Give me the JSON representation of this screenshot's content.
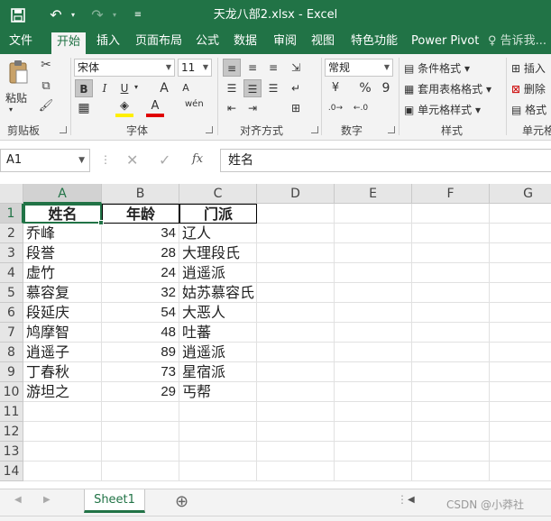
{
  "window": {
    "title": "天龙八部2.xlsx - Excel",
    "qa_save_icon": "save-icon",
    "qa_undo_icon": "undo-icon",
    "qa_redo_icon": "redo-icon",
    "qa_customize_icon": "customize-toolbar-icon"
  },
  "ribbon_tabs": [
    "文件",
    "开始",
    "插入",
    "页面布局",
    "公式",
    "数据",
    "审阅",
    "视图",
    "特色功能",
    "Power Pivot",
    "告诉我..."
  ],
  "active_tab": "开始",
  "ribbon": {
    "clipboard": {
      "label": "剪贴板",
      "paste": "粘贴"
    },
    "font": {
      "label": "字体",
      "name": "宋体",
      "size": "11",
      "bold": "B",
      "italic": "I",
      "underline": "U",
      "grow": "A",
      "shrink": "A",
      "phonetic": "wén"
    },
    "alignment": {
      "label": "对齐方式"
    },
    "number": {
      "label": "数字",
      "format": "常规",
      "percent": "%",
      "comma": "9"
    },
    "styles": {
      "label": "样式",
      "conditional": "条件格式",
      "table": "套用表格格式",
      "cell": "单元格样式"
    },
    "cells": {
      "label": "单元格",
      "insert": "插入",
      "delete": "删除",
      "format": "格式"
    }
  },
  "formula_bar": {
    "name_box": "A1",
    "fx": "fx",
    "content": "姓名"
  },
  "columns": [
    "A",
    "B",
    "C",
    "D",
    "E",
    "F",
    "G"
  ],
  "rows": [
    "1",
    "2",
    "3",
    "4",
    "5",
    "6",
    "7",
    "8",
    "9",
    "10",
    "11",
    "12",
    "13",
    "14"
  ],
  "sheet": {
    "header": [
      "姓名",
      "年龄",
      "门派"
    ],
    "data": [
      [
        "乔峰",
        "34",
        "辽人"
      ],
      [
        "段誉",
        "28",
        "大理段氏"
      ],
      [
        "虚竹",
        "24",
        "逍遥派"
      ],
      [
        "慕容复",
        "32",
        "姑苏慕容氏"
      ],
      [
        "段延庆",
        "54",
        "大恶人"
      ],
      [
        "鸠摩智",
        "48",
        "吐蕃"
      ],
      [
        "逍遥子",
        "89",
        "逍遥派"
      ],
      [
        "丁春秋",
        "73",
        "星宿派"
      ],
      [
        "游坦之",
        "29",
        "丐帮"
      ]
    ]
  },
  "sheet_tabs": {
    "active": "Sheet1"
  },
  "watermark": "CSDN @小莽社"
}
